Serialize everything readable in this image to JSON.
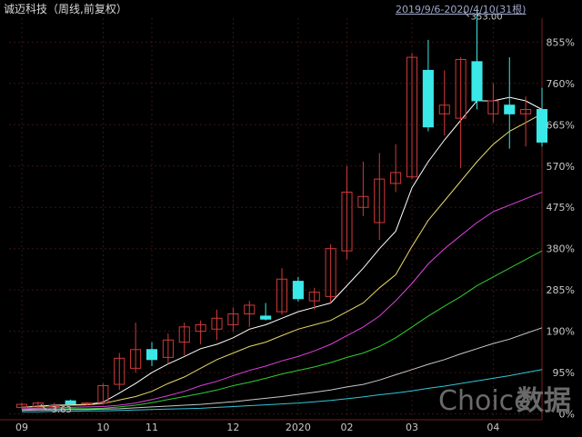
{
  "header": {
    "title": "诚迈科技（周线,前复权）",
    "range": "2019/9/6-2020/4/10(31根)"
  },
  "watermark": {
    "en": "Choice",
    "cn": "数据"
  },
  "colors": {
    "background": "#000000",
    "up": "#d03a3a",
    "down": "#3ae8e8",
    "grid": "#3a1414",
    "ma": [
      "#ffffff",
      "#e8d868",
      "#e040e0",
      "#2fcf2f",
      "#c8c8c8",
      "#2fc8d8"
    ]
  },
  "chart_data": {
    "type": "candlestick",
    "ylim": [
      -5,
      910
    ],
    "yticks": [
      0,
      95,
      190,
      285,
      380,
      475,
      570,
      665,
      760,
      855
    ],
    "ytick_labels": [
      "0%",
      "95%",
      "190%",
      "285%",
      "380%",
      "475%",
      "570%",
      "665%",
      "760%",
      "855%"
    ],
    "xtick_labels": [
      {
        "label": "09",
        "index": 0
      },
      {
        "label": "10",
        "index": 5
      },
      {
        "label": "11",
        "index": 8
      },
      {
        "label": "12",
        "index": 13
      },
      {
        "label": "2020",
        "index": 17
      },
      {
        "label": "02",
        "index": 20
      },
      {
        "label": "03",
        "index": 24
      },
      {
        "label": "04",
        "index": 29
      }
    ],
    "annotations": [
      {
        "text": "353.00",
        "index": 27,
        "value": 930
      },
      {
        "text": "-3.63",
        "index": 1,
        "value": 26
      }
    ],
    "candles": [
      {
        "open": 15,
        "high": 26,
        "low": 11,
        "close": 22
      },
      {
        "open": 16,
        "high": 28,
        "low": 12,
        "close": 25
      },
      {
        "open": 19,
        "high": 26,
        "low": 14,
        "close": 19
      },
      {
        "open": 30,
        "high": 33,
        "low": 22,
        "close": 23
      },
      {
        "open": 24,
        "high": 27,
        "low": 20,
        "close": 25
      },
      {
        "open": 25,
        "high": 70,
        "low": 22,
        "close": 65
      },
      {
        "open": 68,
        "high": 140,
        "low": 55,
        "close": 128
      },
      {
        "open": 105,
        "high": 210,
        "low": 95,
        "close": 148
      },
      {
        "open": 148,
        "high": 165,
        "low": 110,
        "close": 125
      },
      {
        "open": 130,
        "high": 185,
        "low": 115,
        "close": 170
      },
      {
        "open": 165,
        "high": 210,
        "low": 135,
        "close": 200
      },
      {
        "open": 190,
        "high": 215,
        "low": 160,
        "close": 205
      },
      {
        "open": 195,
        "high": 240,
        "low": 170,
        "close": 220
      },
      {
        "open": 205,
        "high": 245,
        "low": 190,
        "close": 230
      },
      {
        "open": 230,
        "high": 260,
        "low": 200,
        "close": 250
      },
      {
        "open": 225,
        "high": 255,
        "low": 215,
        "close": 218
      },
      {
        "open": 235,
        "high": 335,
        "low": 228,
        "close": 310
      },
      {
        "open": 305,
        "high": 315,
        "low": 258,
        "close": 265
      },
      {
        "open": 260,
        "high": 290,
        "low": 240,
        "close": 280
      },
      {
        "open": 270,
        "high": 390,
        "low": 255,
        "close": 380
      },
      {
        "open": 375,
        "high": 570,
        "low": 355,
        "close": 510
      },
      {
        "open": 475,
        "high": 580,
        "low": 455,
        "close": 500
      },
      {
        "open": 440,
        "high": 600,
        "low": 400,
        "close": 540
      },
      {
        "open": 530,
        "high": 620,
        "low": 510,
        "close": 555
      },
      {
        "open": 545,
        "high": 830,
        "low": 540,
        "close": 820
      },
      {
        "open": 790,
        "high": 860,
        "low": 650,
        "close": 660
      },
      {
        "open": 690,
        "high": 790,
        "low": 640,
        "close": 710
      },
      {
        "open": 680,
        "high": 820,
        "low": 565,
        "close": 815
      },
      {
        "open": 810,
        "high": 930,
        "low": 700,
        "close": 720
      },
      {
        "open": 690,
        "high": 760,
        "low": 670,
        "close": 720
      },
      {
        "open": 710,
        "high": 820,
        "low": 610,
        "close": 690
      },
      {
        "open": 690,
        "high": 730,
        "low": 615,
        "close": 700
      },
      {
        "open": 700,
        "high": 750,
        "low": 615,
        "close": 625
      }
    ],
    "moving_averages": [
      {
        "values": [
          15,
          18,
          20,
          21,
          22,
          27,
          48,
          70,
          95,
          115,
          132,
          150,
          160,
          175,
          195,
          205,
          220,
          235,
          245,
          255,
          295,
          335,
          380,
          420,
          520,
          580,
          630,
          675,
          720,
          720,
          728,
          720,
          700
        ]
      },
      {
        "values": [
          15,
          17,
          19,
          20,
          21,
          24,
          32,
          40,
          52,
          70,
          85,
          105,
          125,
          140,
          155,
          165,
          180,
          195,
          205,
          215,
          235,
          255,
          290,
          320,
          385,
          445,
          490,
          535,
          580,
          620,
          650,
          670,
          690
        ]
      },
      {
        "values": [
          12,
          13,
          14,
          15,
          16,
          17,
          20,
          25,
          33,
          42,
          52,
          65,
          75,
          88,
          100,
          110,
          122,
          132,
          145,
          160,
          180,
          200,
          225,
          260,
          300,
          345,
          380,
          410,
          440,
          465,
          480,
          495,
          510
        ]
      },
      {
        "values": [
          10,
          11,
          11,
          12,
          12,
          13,
          16,
          20,
          26,
          33,
          40,
          47,
          55,
          65,
          73,
          82,
          92,
          100,
          108,
          118,
          130,
          140,
          155,
          175,
          200,
          225,
          248,
          270,
          295,
          315,
          335,
          355,
          375
        ]
      },
      {
        "values": [
          8,
          9,
          9,
          10,
          10,
          11,
          12,
          14,
          16,
          18,
          20,
          22,
          25,
          28,
          32,
          36,
          40,
          45,
          50,
          55,
          62,
          68,
          78,
          90,
          102,
          114,
          125,
          138,
          150,
          162,
          172,
          185,
          198
        ]
      },
      {
        "values": [
          5,
          5,
          6,
          6,
          7,
          7,
          8,
          9,
          10,
          11,
          12,
          13,
          15,
          17,
          19,
          21,
          23,
          25,
          28,
          31,
          35,
          39,
          44,
          48,
          53,
          59,
          64,
          70,
          76,
          82,
          88,
          95,
          102
        ]
      }
    ]
  }
}
